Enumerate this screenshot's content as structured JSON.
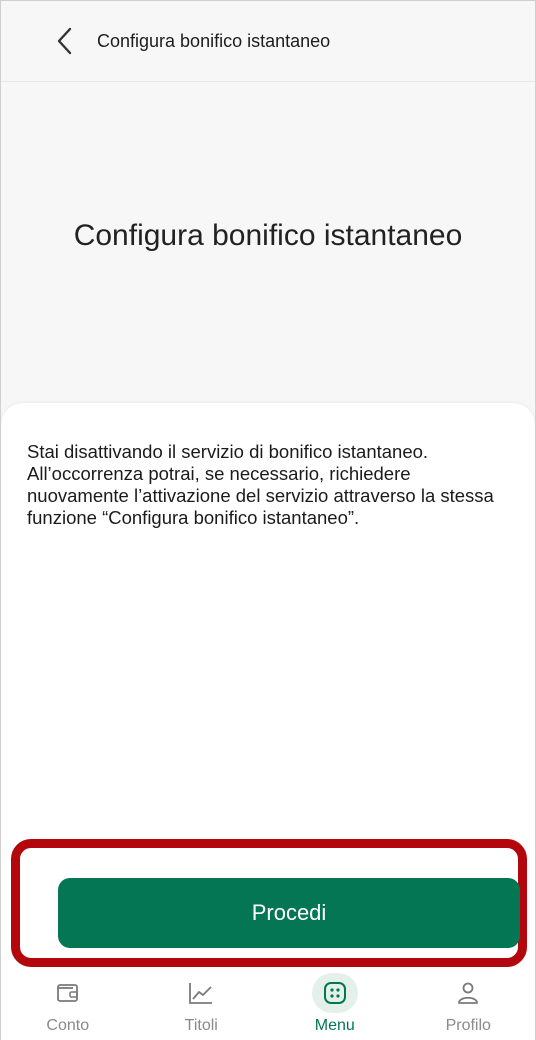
{
  "header": {
    "title": "Configura bonifico istantaneo",
    "back_icon": "chevron-left-icon"
  },
  "hero": {
    "title": "Configura bonifico istantaneo"
  },
  "sheet": {
    "message": "Stai disattivando il servizio di bonifico istantaneo. All’occorrenza potrai, se necessario, richiedere nuovamente l’attivazione del servizio attraverso la stessa funzione “Configura bonifico istantaneo”."
  },
  "actions": {
    "procedi_label": "Procedi"
  },
  "nav": {
    "items": [
      {
        "label": "Conto",
        "icon": "wallet-icon"
      },
      {
        "label": "Titoli",
        "icon": "trend-chart-icon"
      },
      {
        "label": "Menu",
        "icon": "menu-grid-icon",
        "active": true
      },
      {
        "label": "Profilo",
        "icon": "user-icon"
      }
    ]
  },
  "colors": {
    "primary": "#057653",
    "highlight": "#b3070d",
    "active_nav_bg": "#e3f1ea",
    "background": "#f7f7f7"
  }
}
